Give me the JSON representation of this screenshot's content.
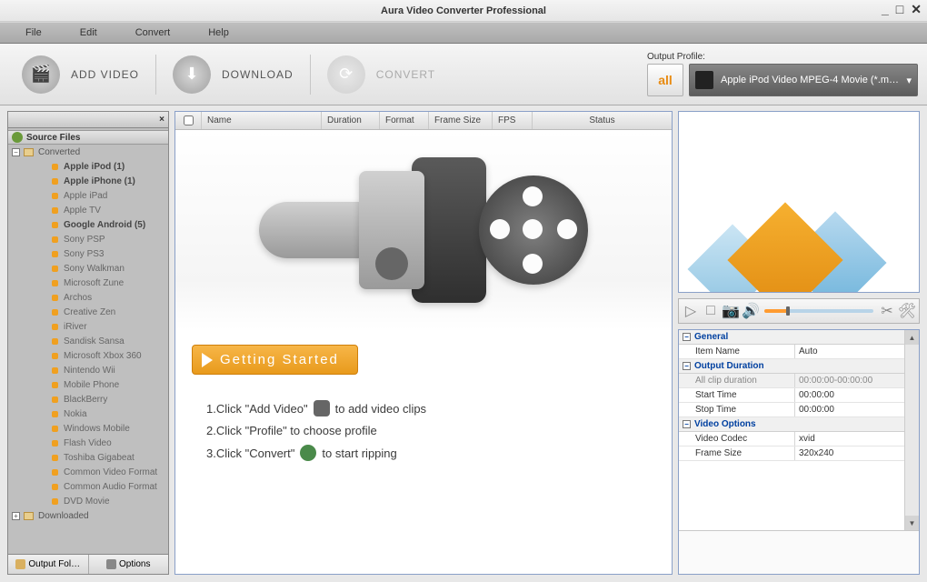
{
  "window": {
    "title": "Aura Video Converter Professional"
  },
  "menu": {
    "file": "File",
    "edit": "Edit",
    "convert": "Convert",
    "help": "Help"
  },
  "toolbar": {
    "add_video": "Add Video",
    "download": "Download",
    "convert": "Convert",
    "output_profile_label": "Output Profile:",
    "all": "all",
    "profile_selected": "Apple iPod Video MPEG-4 Movie (*.m…"
  },
  "sidebar": {
    "close": "×",
    "root_source": "Source Files",
    "root_converted": "Converted",
    "root_downloaded": "Downloaded",
    "items": [
      {
        "label": "Apple iPod (1)",
        "bold": true
      },
      {
        "label": "Apple iPhone (1)",
        "bold": true
      },
      {
        "label": "Apple iPad",
        "bold": false
      },
      {
        "label": "Apple TV",
        "bold": false
      },
      {
        "label": "Google Android (5)",
        "bold": true
      },
      {
        "label": "Sony PSP",
        "bold": false
      },
      {
        "label": "Sony PS3",
        "bold": false
      },
      {
        "label": "Sony Walkman",
        "bold": false
      },
      {
        "label": "Microsoft Zune",
        "bold": false
      },
      {
        "label": "Archos",
        "bold": false
      },
      {
        "label": "Creative Zen",
        "bold": false
      },
      {
        "label": "iRiver",
        "bold": false
      },
      {
        "label": "Sandisk Sansa",
        "bold": false
      },
      {
        "label": "Microsoft Xbox 360",
        "bold": false
      },
      {
        "label": "Nintendo Wii",
        "bold": false
      },
      {
        "label": "Mobile Phone",
        "bold": false
      },
      {
        "label": "BlackBerry",
        "bold": false
      },
      {
        "label": "Nokia",
        "bold": false
      },
      {
        "label": "Windows Mobile",
        "bold": false
      },
      {
        "label": "Flash Video",
        "bold": false
      },
      {
        "label": "Toshiba Gigabeat",
        "bold": false
      },
      {
        "label": "Common Video Format",
        "bold": false
      },
      {
        "label": "Common Audio Format",
        "bold": false
      },
      {
        "label": "DVD Movie",
        "bold": false
      }
    ],
    "footer": {
      "output_folder": "Output Fol…",
      "options": "Options"
    }
  },
  "list_columns": {
    "name": "Name",
    "duration": "Duration",
    "format": "Format",
    "frame_size": "Frame Size",
    "fps": "FPS",
    "status": "Status"
  },
  "main": {
    "getting_started": "Getting Started",
    "step1a": "1.Click \"Add Video\"",
    "step1b": "to add video clips",
    "step2": "2.Click \"Profile\" to choose profile",
    "step3a": "3.Click \"Convert\"",
    "step3b": "to start ripping"
  },
  "props": {
    "sections": {
      "general": "General",
      "output_duration": "Output Duration",
      "video_options": "Video Options"
    },
    "general": {
      "item_name_k": "Item Name",
      "item_name_v": "Auto"
    },
    "output_duration": {
      "all_clip_k": "All clip duration",
      "all_clip_v": "00:00:00-00:00:00",
      "start_k": "Start Time",
      "start_v": "00:00:00",
      "stop_k": "Stop Time",
      "stop_v": "00:00:00"
    },
    "video_options": {
      "codec_k": "Video Codec",
      "codec_v": "xvid",
      "frame_k": "Frame Size",
      "frame_v": "320x240"
    }
  }
}
